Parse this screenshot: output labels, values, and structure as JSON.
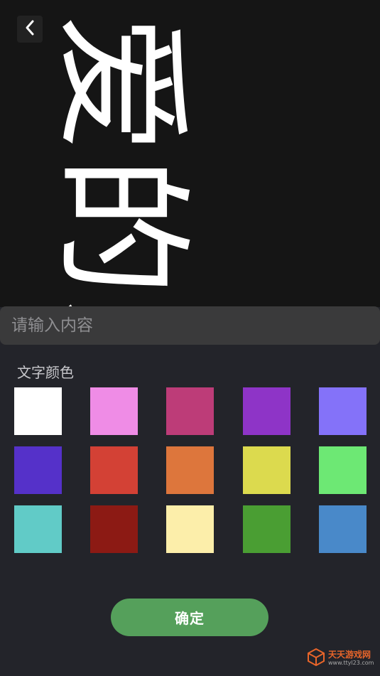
{
  "preview": {
    "text": "爱的爱"
  },
  "back_button": {
    "icon": "chevron-left-icon"
  },
  "input": {
    "placeholder": "请输入内容",
    "value": ""
  },
  "color_section": {
    "label": "文字颜色",
    "swatches": [
      "#ffffff",
      "#ef8ce6",
      "#bd3c78",
      "#8e34c7",
      "#8472f9",
      "#5531c9",
      "#d34135",
      "#dd763c",
      "#dcda4e",
      "#6de874",
      "#61cbc7",
      "#8c1a14",
      "#fceeaa",
      "#4a9e33",
      "#4989c9"
    ]
  },
  "confirm_button": {
    "label": "确定"
  },
  "watermark": {
    "title": "天天游戏网",
    "url": "www.ttyl23.com"
  }
}
